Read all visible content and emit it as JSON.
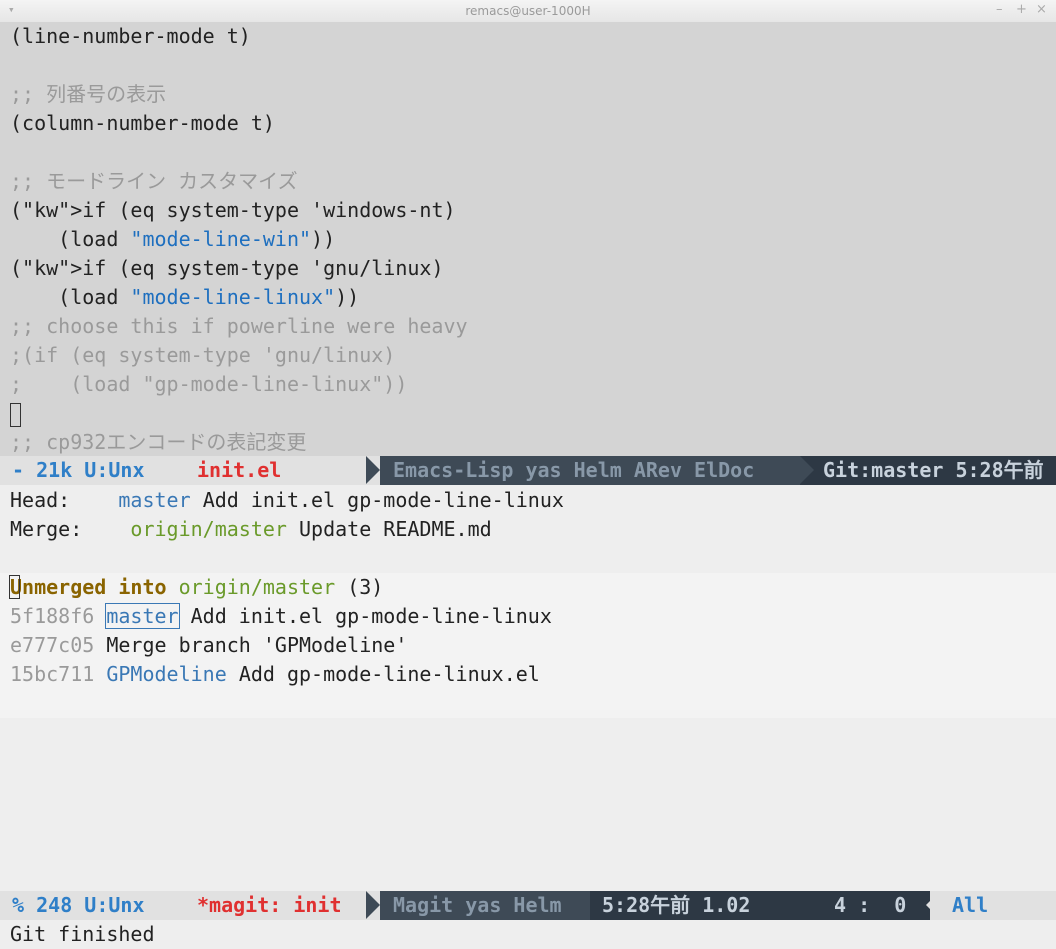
{
  "window": {
    "title": "remacs@user-1000H",
    "controls": [
      "–",
      "+",
      "×"
    ]
  },
  "editor": {
    "lines": [
      "(line-number-mode t)",
      "",
      ";; 列番号の表示",
      "(column-number-mode t)",
      "",
      ";; モードライン カスタマイズ",
      "(if (eq system-type 'windows-nt)",
      "    (load \"mode-line-win\"))",
      "(if (eq system-type 'gnu/linux)",
      "    (load \"mode-line-linux\"))",
      ";; choose this if powerline were heavy",
      ";(if (eq system-type 'gnu/linux)",
      ";    (load \"gp-mode-line-linux\"))",
      "",
      ";; cp932エンコードの表記変更"
    ]
  },
  "modeline1": {
    "status": " - 21k U:Unx",
    "buffer": "init.el",
    "modes": "Emacs-Lisp yas Helm ARev ElDoc",
    "git": "Git:master 5:28午前"
  },
  "magit": {
    "head_label": "Head:",
    "head_branch": "master",
    "head_msg": "Add init.el gp-mode-line-linux",
    "merge_label": "Merge:",
    "merge_branch": "origin/master",
    "merge_msg": "Update README.md",
    "section_title": "Unmerged into",
    "section_branch": "origin/master",
    "section_count": "(3)",
    "commits": [
      {
        "hash": "5f188f6",
        "branch": "master",
        "msg": "Add init.el gp-mode-line-linux"
      },
      {
        "hash": "e777c05",
        "branch": "",
        "msg": "Merge branch 'GPModeline'"
      },
      {
        "hash": "15bc711",
        "branch": "GPModeline",
        "msg": "Add gp-mode-line-linux.el"
      }
    ]
  },
  "modeline2": {
    "status": " % 248 U:Unx",
    "buffer": "*magit: init",
    "modes": "Magit yas Helm",
    "time": "5:28午前 1.02",
    "position": "4 :  0",
    "scroll": "All"
  },
  "minibuffer": {
    "message": "Git finished"
  }
}
